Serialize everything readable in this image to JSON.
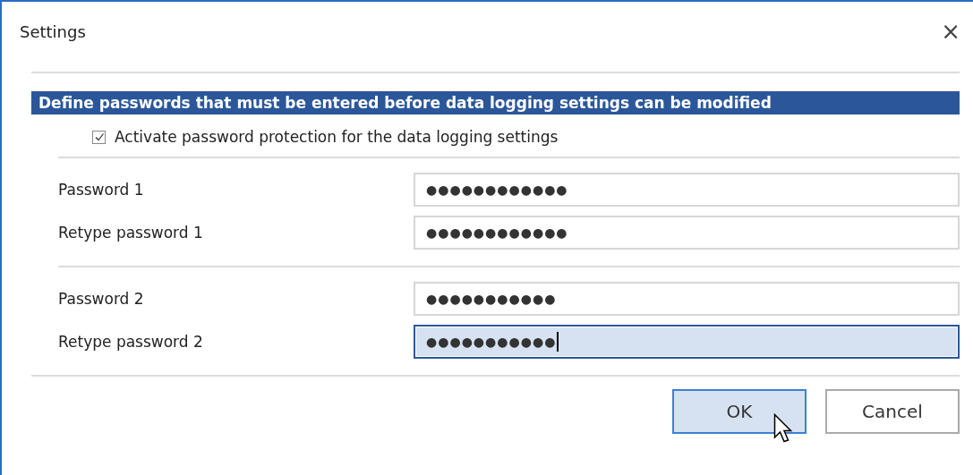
{
  "window": {
    "title": "Settings",
    "close": "×"
  },
  "section": {
    "heading": "Define passwords that must be entered before data logging settings can be modified"
  },
  "protection": {
    "label": "Activate password protection for the data logging settings",
    "checked": true
  },
  "password_groups": [
    {
      "fields": [
        {
          "label": "Password 1",
          "value": "●●●●●●●●●●●●",
          "focused": false
        },
        {
          "label": "Retype password 1",
          "value": "●●●●●●●●●●●●",
          "focused": false
        }
      ]
    },
    {
      "fields": [
        {
          "label": "Password 2",
          "value": "●●●●●●●●●●●",
          "focused": false
        },
        {
          "label": "Retype password 2",
          "value": "●●●●●●●●●●●",
          "focused": true
        }
      ]
    }
  ],
  "buttons": [
    {
      "label": "OK",
      "hovered": true
    },
    {
      "label": "Cancel",
      "hovered": false
    }
  ]
}
